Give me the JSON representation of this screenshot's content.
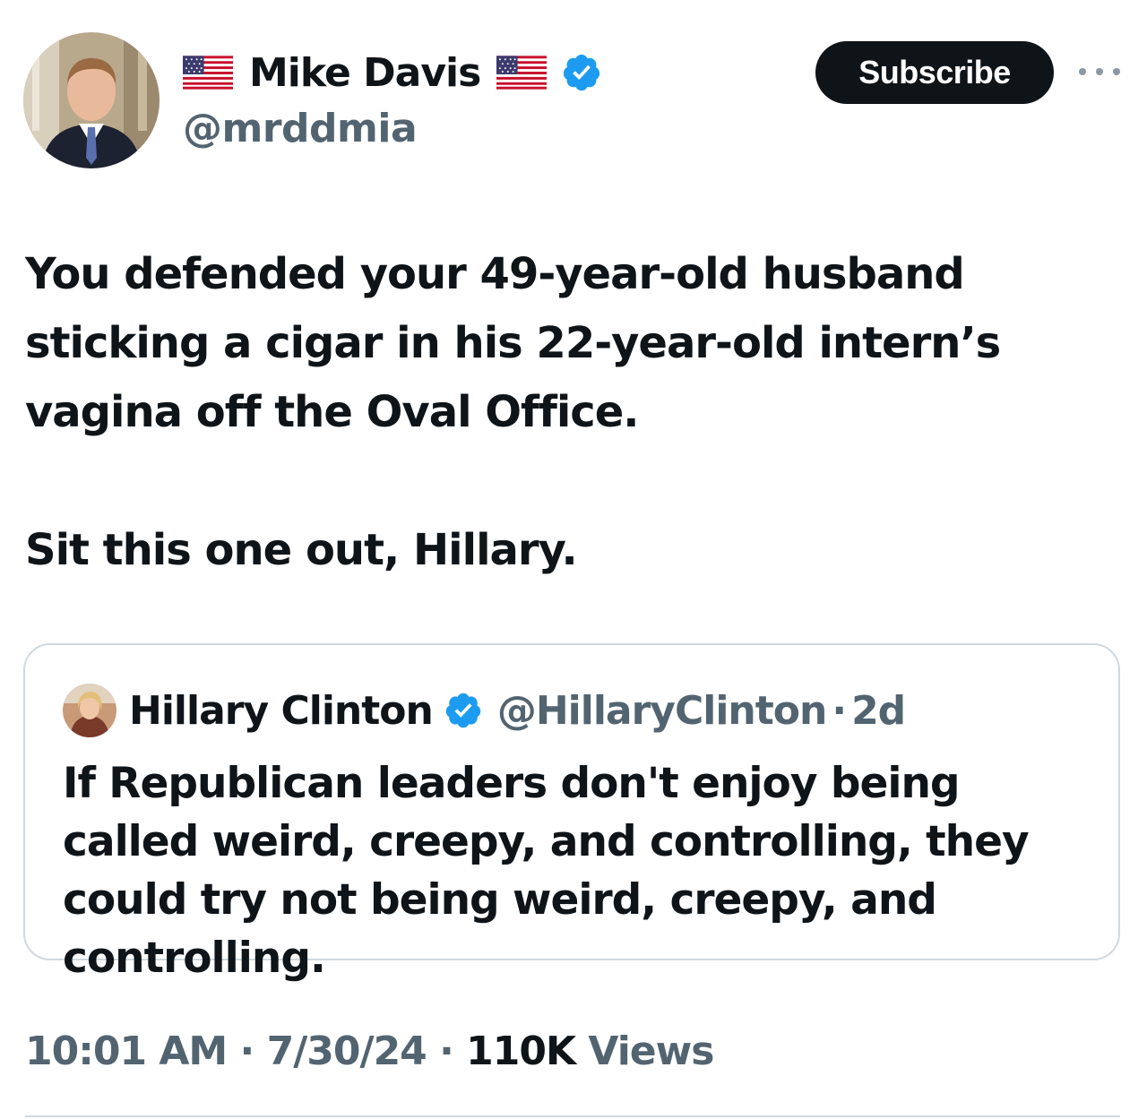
{
  "tweet": {
    "author": {
      "flag_left": "🇺🇸",
      "display_name": "Mike Davis",
      "flag_right": "🇺🇸",
      "handle": "@mrddmia",
      "verified": true,
      "avatar_icon": "person-avatar"
    },
    "subscribe_label": "Subscribe",
    "more_icon": "more-options-icon",
    "text_lines": {
      "paragraph1": "You defended your 49-year-old husband sticking a cigar in his 22-year-old intern’s vagina off the Oval Office.",
      "paragraph2": "Sit this one out, Hillary."
    },
    "quote": {
      "display_name": "Hillary Clinton",
      "verified": true,
      "handle": "@HillaryClinton",
      "separator": "·",
      "time": "2d",
      "text": "If Republican leaders don't enjoy being called weird, creepy, and controlling, they could try not being weird, creepy, and controlling."
    },
    "meta": {
      "time": "10:01 AM",
      "sep1": " · ",
      "date": "7/30/24",
      "sep2": " · ",
      "views_count": "110K",
      "views_label": " Views"
    }
  },
  "colors": {
    "text_primary": "#0f1419",
    "text_secondary": "#536471",
    "verified_blue": "#1d9bf0",
    "border": "#cfd9de",
    "button_bg": "#0f1419"
  }
}
